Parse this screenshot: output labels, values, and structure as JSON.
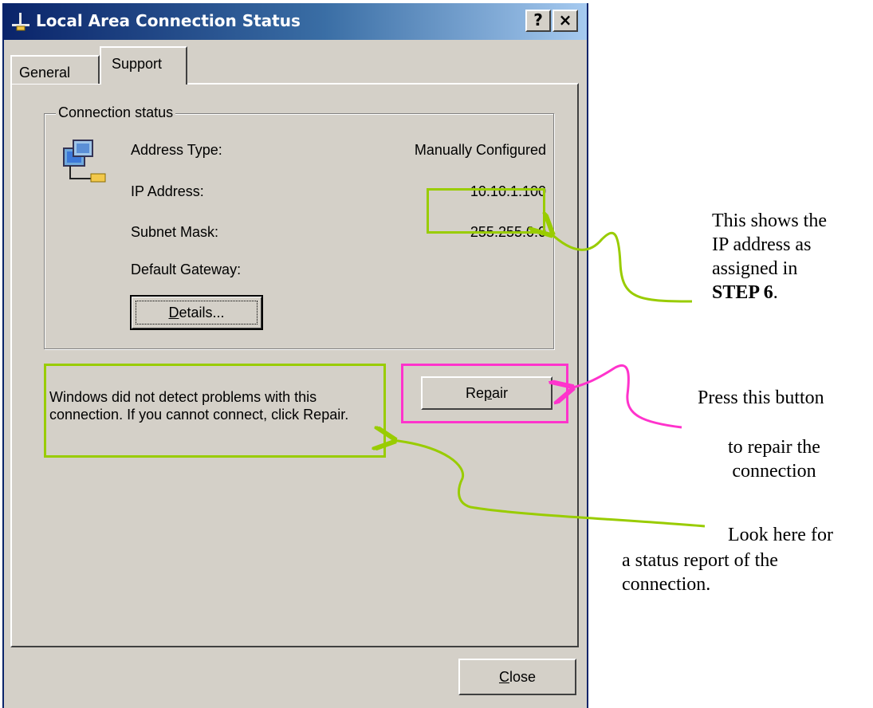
{
  "window": {
    "title": "Local Area Connection Status",
    "help_glyph": "?",
    "close_glyph": "×"
  },
  "tabs": [
    {
      "label": "General"
    },
    {
      "label": "Support"
    }
  ],
  "connection_status": {
    "legend": "Connection status",
    "rows": [
      {
        "label": "Address Type:",
        "value": "Manually Configured"
      },
      {
        "label": "IP Address:",
        "value": "10.10.1.100"
      },
      {
        "label": "Subnet Mask:",
        "value": "255.255.0.0"
      },
      {
        "label": "Default Gateway:",
        "value": ""
      }
    ],
    "details_label": "Details..."
  },
  "status_message": "Windows did not detect problems with this connection. If you cannot connect, click Repair.",
  "buttons": {
    "repair_label": "Repair",
    "close_label": "Close"
  },
  "annotations": {
    "ip_note": {
      "line1": "This shows the",
      "line2": "IP address as",
      "line3": "assigned in",
      "line4_bold": "STEP 6",
      "line4_tail": "."
    },
    "repair_note": {
      "line1": "Press this button",
      "line2": "to repair the",
      "line3": "connection"
    },
    "status_note": {
      "line1": "Look here for",
      "line2": "a status report of the",
      "line3": "connection."
    }
  },
  "colors": {
    "green": "#99cc00",
    "magenta": "#ff33cc",
    "dialog_bg": "#d4d0c8",
    "titlebar_start": "#0a246a"
  }
}
